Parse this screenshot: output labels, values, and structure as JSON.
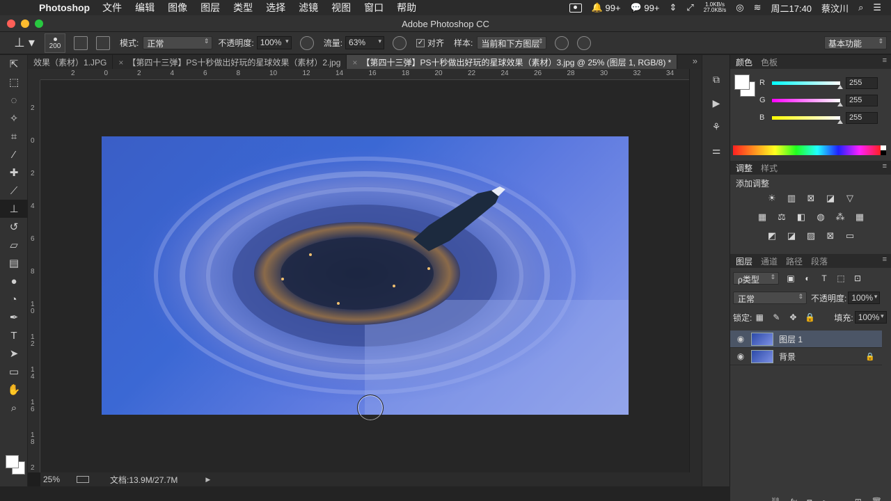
{
  "menubar": {
    "app_name": "Photoshop",
    "items": [
      "文件",
      "编辑",
      "图像",
      "图层",
      "类型",
      "选择",
      "滤镜",
      "视图",
      "窗口",
      "帮助"
    ],
    "qq_badge": "99+",
    "wechat_badge": "99+",
    "net_up": "1.0KB/s",
    "net_down": "27.0KB/s",
    "clock": "周二17:40",
    "user": "蔡汶川"
  },
  "window": {
    "title": "Adobe Photoshop CC"
  },
  "options": {
    "brush_size": "200",
    "mode_label": "模式:",
    "mode_value": "正常",
    "opacity_label": "不透明度:",
    "opacity_value": "100%",
    "flow_label": "流量:",
    "flow_value": "63%",
    "align_label": "对齐",
    "sample_label": "样本:",
    "sample_value": "当前和下方图层",
    "workspace": "基本功能"
  },
  "tabs": [
    {
      "label": "效果（素材）1.JPG"
    },
    {
      "label": "【第四十三弹】PS十秒做出好玩的星球效果（素材）2.jpg"
    },
    {
      "label": "【第四十三弹】PS十秒做出好玩的星球效果（素材）3.jpg @ 25% (图层 1, RGB/8) *"
    }
  ],
  "ruler_h": [
    "2",
    "0",
    "2",
    "4",
    "6",
    "8",
    "10",
    "12",
    "14",
    "16",
    "18",
    "20",
    "22",
    "24",
    "26",
    "28",
    "30",
    "32",
    "34"
  ],
  "ruler_v": [
    "2",
    "0",
    "2",
    "4",
    "6",
    "8",
    "1 0",
    "1 2",
    "1 4",
    "1 6",
    "1 8",
    "2"
  ],
  "status": {
    "zoom": "25%",
    "doc_info": "文档:13.9M/27.7M"
  },
  "color_panel": {
    "tabs": [
      "颜色",
      "色板"
    ],
    "r_label": "R",
    "r": "255",
    "g_label": "G",
    "g": "255",
    "b_label": "B",
    "b": "255",
    "fg_color": "#ffffff",
    "bg_color": "#ffffff"
  },
  "adjust_panel": {
    "tabs": [
      "调整",
      "样式"
    ],
    "title": "添加调整"
  },
  "layers_panel": {
    "tabs": [
      "图层",
      "通道",
      "路径",
      "段落"
    ],
    "filter_label": "ρ类型",
    "blend_mode": "正常",
    "opacity_label": "不透明度:",
    "opacity": "100%",
    "lock_label": "锁定:",
    "fill_label": "填充:",
    "fill": "100%",
    "layers": [
      {
        "name": "图层 1",
        "selected": true
      },
      {
        "name": "背景",
        "selected": false,
        "locked": true
      }
    ]
  }
}
